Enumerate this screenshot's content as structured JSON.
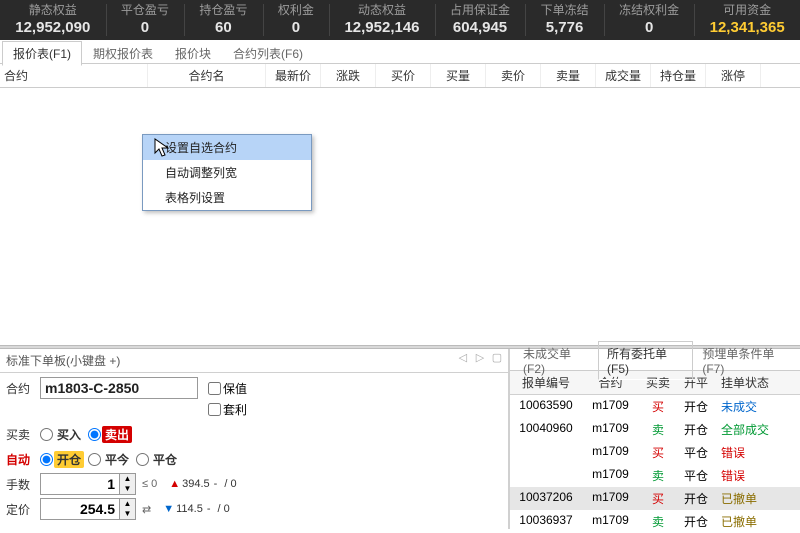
{
  "stats": [
    {
      "label": "静态权益",
      "value": "12,952,090",
      "cls": "white"
    },
    {
      "label": "平仓盈亏",
      "value": "0",
      "cls": "white"
    },
    {
      "label": "持仓盈亏",
      "value": "60",
      "cls": "white"
    },
    {
      "label": "权利金",
      "value": "0",
      "cls": "white"
    },
    {
      "label": "动态权益",
      "value": "12,952,146",
      "cls": "white"
    },
    {
      "label": "占用保证金",
      "value": "604,945",
      "cls": "white"
    },
    {
      "label": "下单冻结",
      "value": "5,776",
      "cls": "white"
    },
    {
      "label": "冻结权利金",
      "value": "0",
      "cls": "white"
    },
    {
      "label": "可用资金",
      "value": "12,341,365",
      "cls": "yellow"
    }
  ],
  "nav_tabs": {
    "quote": "报价表(F1)",
    "option": "期权报价表",
    "block": "报价块",
    "list": "合约列表(F6)"
  },
  "price_cols": [
    "合约",
    "合约名",
    "最新价",
    "涨跌",
    "买价",
    "买量",
    "卖价",
    "卖量",
    "成交量",
    "持仓量",
    "涨停"
  ],
  "context_menu": {
    "item1": "设置自选合约",
    "item2": "自动调整列宽",
    "item3": "表格列设置"
  },
  "order_panel": {
    "title": "标准下单板(小键盘 +)",
    "labels": {
      "contract": "合约",
      "buysell": "买卖",
      "auto": "自动",
      "qty": "手数",
      "price": "定价"
    },
    "contract_value": "m1803-C-2850",
    "chk_hedge": "保值",
    "chk_arb": "套利",
    "radio_buy": "买入",
    "radio_sell": "卖出",
    "radio_open": "开仓",
    "radio_today": "平今",
    "radio_close": "平仓",
    "qty_value": "1",
    "qty_limit": "≤ 0",
    "price_value": "254.5",
    "ref_up": "394.5",
    "ref_down": "114.5",
    "ref_dash1": " / 0",
    "ref_dash2": " / 0"
  },
  "list_tabs": {
    "pending": "未成交单(F2)",
    "all": "所有委托单(F5)",
    "cond": "预埋单条件单(F7)"
  },
  "list_cols": [
    "报单编号",
    "合约",
    "买卖",
    "开平",
    "挂单状态"
  ],
  "orders": [
    {
      "id": "10063590",
      "contract": "m1709",
      "bs": "买",
      "bs_cls": "txt-red",
      "oc": "开仓",
      "status": "未成交",
      "st_cls": "txt-blue",
      "hl": false
    },
    {
      "id": "10040960",
      "contract": "m1709",
      "bs": "卖",
      "bs_cls": "txt-green",
      "oc": "开仓",
      "status": "全部成交",
      "st_cls": "txt-green",
      "hl": false
    },
    {
      "id": "",
      "contract": "m1709",
      "bs": "买",
      "bs_cls": "txt-red",
      "oc": "平仓",
      "status": "错误",
      "st_cls": "txt-red",
      "hl": false
    },
    {
      "id": "",
      "contract": "m1709",
      "bs": "卖",
      "bs_cls": "txt-green",
      "oc": "平仓",
      "status": "错误",
      "st_cls": "txt-red",
      "hl": false
    },
    {
      "id": "10037206",
      "contract": "m1709",
      "bs": "买",
      "bs_cls": "txt-red",
      "oc": "开仓",
      "status": "已撤单",
      "st_cls": "txt-dkyellow",
      "hl": true
    },
    {
      "id": "10036937",
      "contract": "m1709",
      "bs": "卖",
      "bs_cls": "txt-green",
      "oc": "开仓",
      "status": "已撤单",
      "st_cls": "txt-dkyellow",
      "hl": false
    }
  ]
}
